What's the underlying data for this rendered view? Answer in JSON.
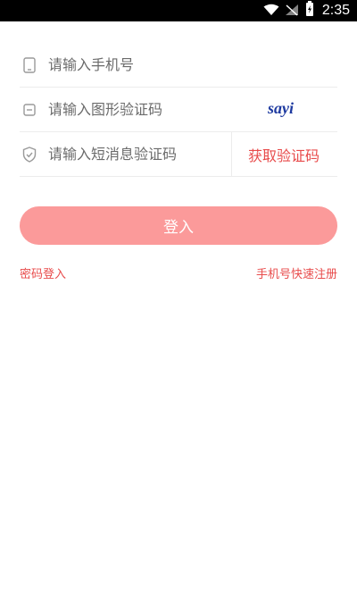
{
  "status_bar": {
    "time": "2:35"
  },
  "form": {
    "phone": {
      "placeholder": "请输入手机号",
      "value": ""
    },
    "captcha": {
      "placeholder": "请输入图形验证码",
      "value": "",
      "image_text": "sayi"
    },
    "sms": {
      "placeholder": "请输入短消息验证码",
      "value": "",
      "button_label": "获取验证码"
    }
  },
  "login_button": {
    "label": "登入"
  },
  "links": {
    "password_login": "密码登入",
    "quick_register": "手机号快速注册"
  },
  "colors": {
    "accent": "#e84b4b",
    "button_bg": "#fb9a9a"
  }
}
